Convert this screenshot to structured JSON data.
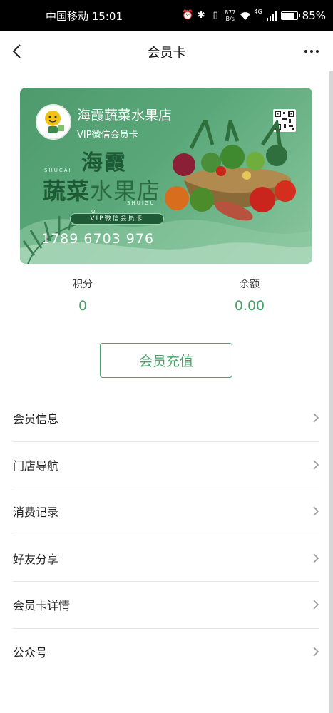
{
  "status_bar": {
    "carrier_time": "中国移动 15:01",
    "net_speed_value": "877",
    "net_speed_unit": "B/s",
    "network_type": "4G",
    "battery_percent": "85%",
    "battery_level": 0.85,
    "icons": [
      "alarm-icon",
      "bluetooth-icon",
      "vibrate-icon",
      "wifi-icon",
      "signal-icon",
      "battery-icon"
    ]
  },
  "nav": {
    "title": "会员卡"
  },
  "card": {
    "store_name": "海霞蔬菜水果店",
    "card_type": "VIP微信会员卡",
    "hero_line1": "海霞",
    "hero_line2_bold": "蔬菜",
    "hero_line2_light": "水果店",
    "pinyin1": "SHUCAI",
    "pinyin2": "SHUIGU",
    "letter_o": "O",
    "pill_text": "VIP微信会员卡",
    "card_number": "1789 6703 976",
    "colors": {
      "primary": "#5aa87a",
      "dark": "#1f5a36"
    }
  },
  "stats": {
    "points_label": "积分",
    "points_value": "0",
    "balance_label": "余额",
    "balance_value": "0.00"
  },
  "recharge_label": "会员充值",
  "menu": [
    {
      "label": "会员信息"
    },
    {
      "label": "门店导航"
    },
    {
      "label": "消费记录"
    },
    {
      "label": "好友分享"
    },
    {
      "label": "会员卡详情"
    },
    {
      "label": "公众号"
    }
  ],
  "accent_color": "#4aa26a"
}
